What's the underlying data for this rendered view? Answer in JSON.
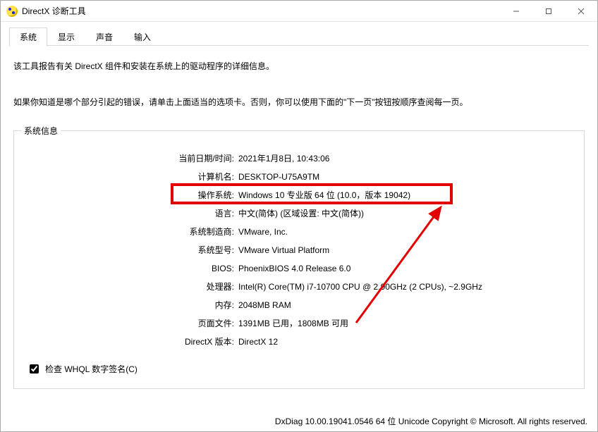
{
  "window": {
    "title": "DirectX 诊断工具"
  },
  "tabs": {
    "system": "系统",
    "display": "显示",
    "sound": "声音",
    "input": "输入"
  },
  "intro": {
    "line1": "该工具报告有关 DirectX 组件和安装在系统上的驱动程序的详细信息。",
    "line2": "如果你知道是哪个部分引起的错误，请单击上面适当的选项卡。否则，你可以使用下面的\"下一页\"按钮按顺序查阅每一页。"
  },
  "group": {
    "legend": "系统信息"
  },
  "labels": {
    "datetime": "当前日期/时间:",
    "computer": "计算机名:",
    "os": "操作系统:",
    "lang": "语言:",
    "mfr": "系统制造商:",
    "model": "系统型号:",
    "bios": "BIOS:",
    "cpu": "处理器:",
    "mem": "内存:",
    "page": "页面文件:",
    "dx": "DirectX 版本:"
  },
  "values": {
    "datetime": "2021年1月8日, 10:43:06",
    "computer": "DESKTOP-U75A9TM",
    "os": "Windows 10 专业版 64 位 (10.0，版本 19042)",
    "lang": "中文(简体) (区域设置: 中文(简体))",
    "mfr": "VMware, Inc.",
    "model": "VMware Virtual Platform",
    "bios": "PhoenixBIOS 4.0 Release 6.0",
    "cpu": "Intel(R) Core(TM) i7-10700 CPU @ 2.90GHz (2 CPUs), ~2.9GHz",
    "mem": "2048MB RAM",
    "page": "1391MB 已用，1808MB 可用",
    "dx": "DirectX 12"
  },
  "whql": {
    "label": "检查 WHQL 数字签名(C)",
    "checked": true
  },
  "footer": {
    "text": "DxDiag 10.00.19041.0546 64 位 Unicode  Copyright © Microsoft. All rights reserved."
  }
}
